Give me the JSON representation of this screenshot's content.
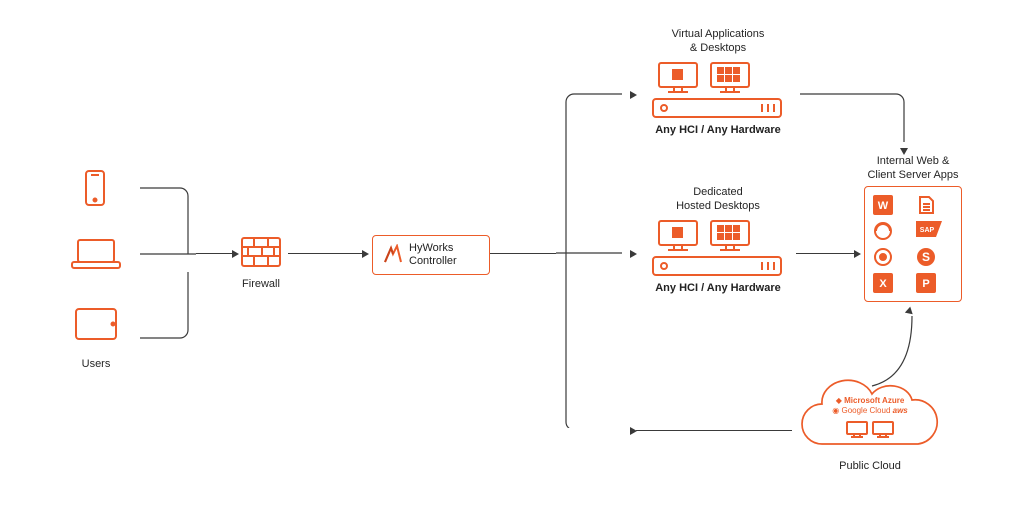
{
  "users": {
    "label": "Users"
  },
  "firewall": {
    "label": "Firewall"
  },
  "controller": {
    "line1": "HyWorks",
    "line2": "Controller"
  },
  "virtual": {
    "title1": "Virtual Applications",
    "title2": "& Desktops",
    "sub": "Any HCI / Any Hardware"
  },
  "dedicated": {
    "title1": "Dedicated",
    "title2": "Hosted Desktops",
    "sub": "Any HCI / Any Hardware"
  },
  "apps": {
    "title1": "Internal Web &",
    "title2": "Client Server Apps"
  },
  "cloud": {
    "label": "Public Cloud",
    "azure": "Microsoft Azure",
    "google": "Google Cloud",
    "aws": "aws"
  }
}
